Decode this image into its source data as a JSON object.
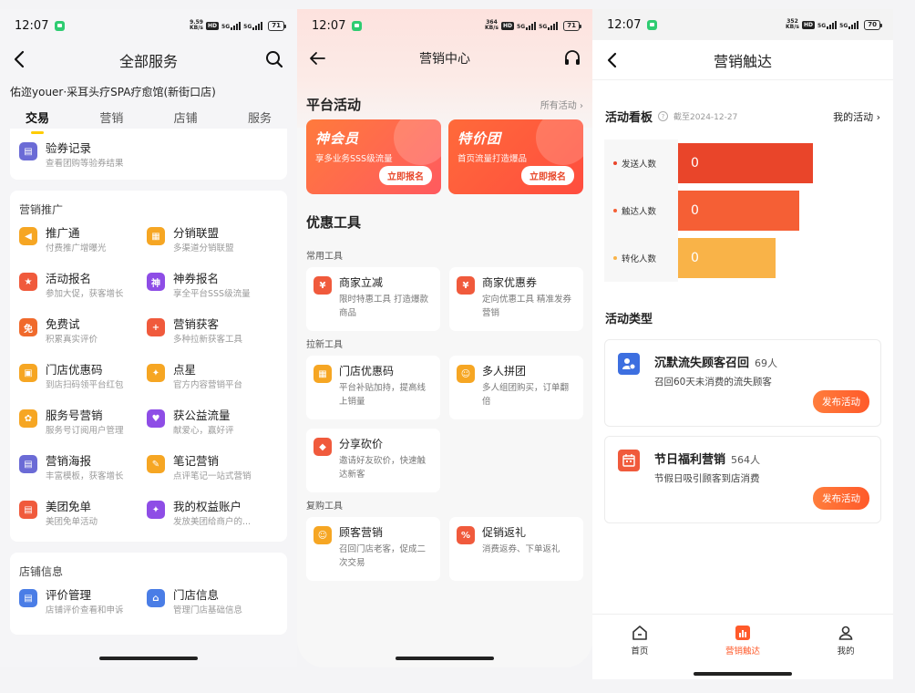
{
  "screen1": {
    "status": {
      "time": "12:07",
      "speed_top": "9.59",
      "speed_bot": "KB/s",
      "hd": "HD",
      "net1": "5G",
      "net2": "5G",
      "battery": "71"
    },
    "title": "全部服务",
    "store": "佑迩youer·采耳头疗SPA疗愈馆(新街口店)",
    "tabs": [
      "交易",
      "营销",
      "店铺",
      "服务"
    ],
    "top_item": {
      "title": "验券记录",
      "subtitle": "查看团购等验券结果",
      "color": "#6b6bd6"
    },
    "marketing": {
      "heading": "营销推广",
      "items": [
        {
          "title": "推广通",
          "subtitle": "付费推广增曝光",
          "color": "#f6a623",
          "glyph": "◀"
        },
        {
          "title": "分销联盟",
          "subtitle": "多渠道分销联盟",
          "color": "#f6a623",
          "glyph": "▦"
        },
        {
          "title": "活动报名",
          "subtitle": "参加大促，获客增长",
          "color": "#f05a3c",
          "glyph": "★"
        },
        {
          "title": "神券报名",
          "subtitle": "享全平台SSS级流量",
          "color": "#8e4de6",
          "glyph": "神"
        },
        {
          "title": "免费试",
          "subtitle": "积累真实评价",
          "color": "#f06a2c",
          "glyph": "免"
        },
        {
          "title": "营销获客",
          "subtitle": "多种拉新获客工具",
          "color": "#f05a3c",
          "glyph": "+"
        },
        {
          "title": "门店优惠码",
          "subtitle": "到店扫码领平台红包",
          "color": "#f6a623",
          "glyph": "▣"
        },
        {
          "title": "点星",
          "subtitle": "官方内容营销平台",
          "color": "#f6a623",
          "glyph": "✦"
        },
        {
          "title": "服务号营销",
          "subtitle": "服务号订阅用户管理",
          "color": "#f6a623",
          "glyph": "✿"
        },
        {
          "title": "获公益流量",
          "subtitle": "献爱心，赢好评",
          "color": "#8e4de6",
          "glyph": "♥"
        },
        {
          "title": "营销海报",
          "subtitle": "丰富模板，获客增长",
          "color": "#6b6bd6",
          "glyph": "▤"
        },
        {
          "title": "笔记营销",
          "subtitle": "点评笔记一站式营销",
          "color": "#f6a623",
          "glyph": "✎"
        },
        {
          "title": "美团免单",
          "subtitle": "美团免单活动",
          "color": "#f05a3c",
          "glyph": "▤"
        },
        {
          "title": "我的权益账户",
          "subtitle": "发放美团给商户的...",
          "color": "#8e4de6",
          "glyph": "✦"
        }
      ]
    },
    "store_info": {
      "heading": "店铺信息",
      "items": [
        {
          "title": "评价管理",
          "subtitle": "店铺评价查看和申诉",
          "color": "#4a7de6",
          "glyph": "▤"
        },
        {
          "title": "门店信息",
          "subtitle": "管理门店基础信息",
          "color": "#4a7de6",
          "glyph": "⌂"
        }
      ]
    }
  },
  "screen2": {
    "status": {
      "time": "12:07",
      "speed_top": "364",
      "speed_bot": "KB/s",
      "hd": "HD",
      "net1": "5G",
      "net2": "5G",
      "battery": "71"
    },
    "title": "营销中心",
    "platform": {
      "heading": "平台活动",
      "more": "所有活动 ›"
    },
    "banners": [
      {
        "title": "神会员",
        "subtitle": "享多业务SSS级流量",
        "button": "立即报名"
      },
      {
        "title": "特价团",
        "subtitle": "首页流量打造爆品",
        "button": "立即报名"
      }
    ],
    "tools_heading": "优惠工具",
    "groups": [
      {
        "heading": "常用工具",
        "items": [
          {
            "title": "商家立减",
            "subtitle": "限时特惠工具 打造爆款商品",
            "color": "#f05a3c",
            "glyph": "¥"
          },
          {
            "title": "商家优惠券",
            "subtitle": "定向优惠工具 精准发券营销",
            "color": "#f05a3c",
            "glyph": "¥"
          }
        ]
      },
      {
        "heading": "拉新工具",
        "items": [
          {
            "title": "门店优惠码",
            "subtitle": "平台补贴加持，提高线上销量",
            "color": "#f6a623",
            "glyph": "▦"
          },
          {
            "title": "多人拼团",
            "subtitle": "多人组团购买，订单翻倍",
            "color": "#f6a623",
            "glyph": "☺"
          },
          {
            "title": "分享砍价",
            "subtitle": "邀请好友砍价，快速触达新客",
            "color": "#f05a3c",
            "glyph": "◆"
          }
        ]
      },
      {
        "heading": "复购工具",
        "items": [
          {
            "title": "顾客营销",
            "subtitle": "召回门店老客，促成二次交易",
            "color": "#f6a623",
            "glyph": "☺"
          },
          {
            "title": "促销返礼",
            "subtitle": "消费返券、下单返礼",
            "color": "#f05a3c",
            "glyph": "%"
          }
        ]
      }
    ]
  },
  "screen3": {
    "status": {
      "time": "12:07",
      "speed_top": "352",
      "speed_bot": "KB/s",
      "hd": "HD",
      "net1": "5G",
      "net2": "5G",
      "battery": "70"
    },
    "title": "营销触达",
    "kanban": {
      "heading": "活动看板",
      "help": "?",
      "date": "截至2024-12-27",
      "my": "我的活动 ›"
    },
    "funnel": [
      {
        "label": "发送人数",
        "value": "0",
        "color": "#e9452a",
        "dot": "#e9452a",
        "fill": 0.8
      },
      {
        "label": "触达人数",
        "value": "0",
        "color": "#f55f35",
        "dot": "#f55f35",
        "fill": 0.72
      },
      {
        "label": "转化人数",
        "value": "0",
        "color": "#f9b348",
        "dot": "#f9b348",
        "fill": 0.58
      }
    ],
    "types_heading": "活动类型",
    "types": [
      {
        "title": "沉默流失顾客召回",
        "count": "69人",
        "subtitle": "召回60天未消费的流失顾客",
        "button": "发布活动",
        "color": "#3d6fe0"
      },
      {
        "title": "节日福利营销",
        "count": "564人",
        "subtitle": "节假日吸引顾客到店消费",
        "button": "发布活动",
        "color": "#f05a3c"
      }
    ],
    "tabbar": [
      {
        "label": "首页",
        "active": false
      },
      {
        "label": "营销触达",
        "active": true
      },
      {
        "label": "我的",
        "active": false
      }
    ]
  }
}
